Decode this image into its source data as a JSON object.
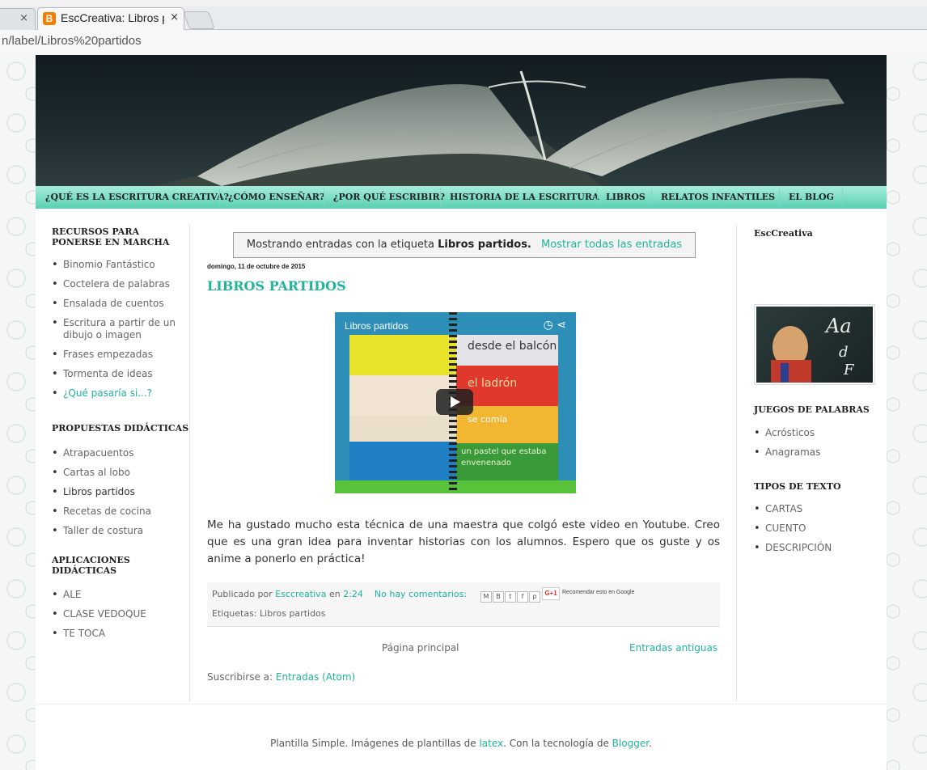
{
  "browser": {
    "tab_title": "EscCreativa: Libros p",
    "tab_close": "×",
    "prev_tab_close": "×",
    "url": "n/label/Libros%20partidos"
  },
  "nav": {
    "items": [
      "¿QUÉ ES LA ESCRITURA CREATIVA?",
      "¿CÓMO ENSEÑAR?",
      "¿POR QUÉ ESCRIBIR?",
      "HISTORIA DE LA ESCRITURA",
      "LIBROS",
      "RELATOS INFANTILES",
      "EL BLOG"
    ]
  },
  "left_sidebar": {
    "recursos": {
      "title": "RECURSOS PARA PONERSE EN MARCHA",
      "items": [
        "Binomio Fantástico",
        "Coctelera de palabras",
        "Ensalada de cuentos",
        "Escritura a partir de un dibujo o imagen",
        "Frases empezadas",
        "Tormenta de ideas",
        "¿Qué pasaría si...?"
      ]
    },
    "propuestas": {
      "title": "PROPUESTAS DIDÁCTICAS",
      "items": [
        "Atrapacuentos",
        "Cartas al lobo",
        "Libros partidos",
        "Recetas de cocina",
        "Taller de costura"
      ]
    },
    "aplicaciones": {
      "title": "APLICACIONES DIDÁCTICAS",
      "items": [
        "ALE",
        "CLASE VEDOQUE",
        "TE TOCA"
      ]
    }
  },
  "main": {
    "status_prefix": "Mostrando entradas con la etiqueta",
    "status_label": "Libros partidos.",
    "status_link": "Mostrar todas las entradas",
    "date": "domingo, 11 de octubre de 2015",
    "post_title": "LIBROS PARTIDOS",
    "video": {
      "title": "Libros partidos",
      "strips": [
        "desde el balcón",
        "el ladrón",
        "se comía",
        "un pastel que estaba envenenado"
      ]
    },
    "post_body": "Me ha gustado mucho esta técnica de una maestra que colgó este video en Youtube. Creo que es una gran idea para inventar historias con los alumnos. Espero que os guste y os anime a ponerlo en práctica!",
    "footer": {
      "published_by": "Publicado por",
      "author": "Esccreativa",
      "en": "en",
      "time": "2:24",
      "comments": "No hay comentarios:",
      "gplus": "G+1",
      "recommend": "Recomendar esto en Google",
      "labels_prefix": "Etiquetas:",
      "label": "Libros partidos"
    },
    "pager": {
      "home": "Página principal",
      "older": "Entradas antiguas"
    },
    "subscribe_prefix": "Suscribirse a:",
    "subscribe_link": "Entradas (Atom)",
    "attribution_1": "Plantilla Simple. Imágenes de plantillas de",
    "attribution_link1": "latex",
    "attribution_2": ". Con la tecnología de",
    "attribution_link2": "Blogger",
    "attribution_3": "."
  },
  "right_sidebar": {
    "profile_title": "EscCreativa",
    "juegos": {
      "title": "JUEGOS DE PALABRAS",
      "items": [
        "Acrósticos",
        "Anagramas"
      ]
    },
    "tipos": {
      "title": "TIPOS DE TEXTO",
      "items": [
        "CARTAS",
        "CUENTO",
        "DESCRIPCIÓN"
      ]
    }
  },
  "colors": {
    "accent": "#1fb59a",
    "nav_bg": "#59cfb3"
  }
}
